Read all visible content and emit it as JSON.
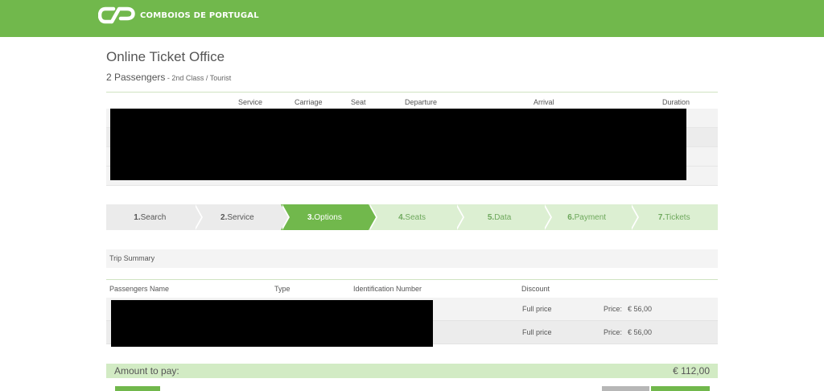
{
  "header": {
    "brand_name": "COMBOIOS DE PORTUGAL",
    "logo_icon": "cp-logo-icon",
    "color": "#71b84c"
  },
  "page": {
    "title": "Online Ticket Office",
    "passengers": "2 Passengers",
    "class_info": " - 2nd Class / Tourist"
  },
  "trip_table": {
    "headers": [
      "Service",
      "Carriage",
      "Seat",
      "Departure",
      "Arrival",
      "Duration"
    ]
  },
  "steps": [
    {
      "num": "1.",
      "label": "Search",
      "state": "done"
    },
    {
      "num": "2.",
      "label": "Service",
      "state": "done"
    },
    {
      "num": "3.",
      "label": "Options",
      "state": "active"
    },
    {
      "num": "4.",
      "label": "Seats",
      "state": "todo"
    },
    {
      "num": "5.",
      "label": "Data",
      "state": "todo"
    },
    {
      "num": "6.",
      "label": "Payment",
      "state": "todo"
    },
    {
      "num": "7.",
      "label": "Tickets",
      "state": "todo"
    }
  ],
  "summary": {
    "label": "Trip Summary"
  },
  "passengers_table": {
    "headers": [
      "Passengers Name",
      "Type",
      "Identification Number",
      "Discount"
    ],
    "rows": [
      {
        "discount": "Full price",
        "price_label": "Price:",
        "price": "€ 56,00"
      },
      {
        "discount": "Full price",
        "price_label": "Price:",
        "price": "€ 56,00"
      }
    ]
  },
  "total": {
    "label": "Amount to pay:",
    "value": "€ 112,00"
  }
}
